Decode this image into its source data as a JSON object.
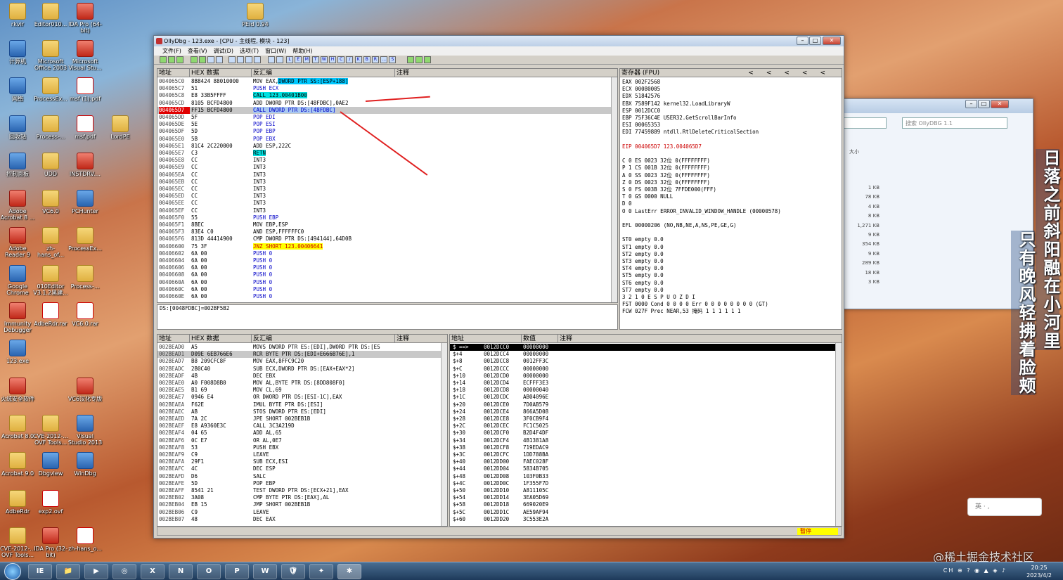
{
  "desktop_icons": [
    {
      "label": "rkvir",
      "icon": "file-icon",
      "kind": "folder"
    },
    {
      "label": "Editor010...",
      "icon": "folder-icon",
      "kind": "folder"
    },
    {
      "label": "IDA Pro (64-bit)",
      "icon": "ida-icon",
      "kind": "red"
    },
    {
      "label": "计算机",
      "icon": "computer-icon",
      "kind": "app"
    },
    {
      "label": "Microsoft Office 2003",
      "icon": "folder-icon",
      "kind": "folder"
    },
    {
      "label": "Microsoft Visual Stu...",
      "icon": "vs-icon",
      "kind": "red"
    },
    {
      "label": "网络",
      "icon": "network-icon",
      "kind": "app"
    },
    {
      "label": "ProcessEx...",
      "icon": "folder-icon",
      "kind": "folder"
    },
    {
      "label": "msf (1).pdf",
      "icon": "pdf-icon",
      "kind": "pdf"
    },
    {
      "label": "回收站",
      "icon": "recycle-bin-icon",
      "kind": "app"
    },
    {
      "label": "Process-...",
      "icon": "folder-icon",
      "kind": "folder"
    },
    {
      "label": "msf.pdf",
      "icon": "pdf-icon",
      "kind": "pdf"
    },
    {
      "label": "LordPE",
      "icon": "lordpe-icon",
      "kind": "folder"
    },
    {
      "label": "控制面板",
      "icon": "control-panel-icon",
      "kind": "app"
    },
    {
      "label": "UDD",
      "icon": "folder-icon",
      "kind": "folder"
    },
    {
      "label": "INSTDRV....",
      "icon": "sys-icon",
      "kind": "red"
    },
    {
      "label": "Adobe Acrobat 8 ...",
      "icon": "acrobat-icon",
      "kind": "red"
    },
    {
      "label": "VC6.0",
      "icon": "folder-icon",
      "kind": "folder"
    },
    {
      "label": "PCHunter",
      "icon": "pchunter-icon",
      "kind": "app"
    },
    {
      "label": "Adobe Reader 9",
      "icon": "reader-icon",
      "kind": "red"
    },
    {
      "label": "zh-hans_of...",
      "icon": "folder-icon",
      "kind": "folder"
    },
    {
      "label": "ProcessEx...",
      "icon": "folder-icon",
      "kind": "folder"
    },
    {
      "label": "Google Chrome",
      "icon": "chrome-icon",
      "kind": "app"
    },
    {
      "label": "010Editor V3.1.2黑建...",
      "icon": "editor-icon",
      "kind": "folder"
    },
    {
      "label": "Process-...",
      "icon": "folder-icon",
      "kind": "folder"
    },
    {
      "label": "Immunity Debugger",
      "icon": "immunity-icon",
      "kind": "red"
    },
    {
      "label": "AdbeRdr.rar",
      "icon": "archive-icon",
      "kind": "pdf"
    },
    {
      "label": "VC6.0.rar",
      "icon": "archive-icon",
      "kind": "pdf"
    },
    {
      "label": "123.exe",
      "icon": "exe-icon",
      "kind": "app"
    },
    {
      "label": "火绒安全软件",
      "icon": "huorong-icon",
      "kind": "red"
    },
    {
      "label": "VC6汉化专版",
      "icon": "vc6-icon",
      "kind": "red"
    },
    {
      "label": "Acrobat 8.0",
      "icon": "folder-icon",
      "kind": "folder"
    },
    {
      "label": "CVE-2012-... OVF Tools...",
      "icon": "folder-icon",
      "kind": "folder"
    },
    {
      "label": "Visual Studio 2013",
      "icon": "vs2013-icon",
      "kind": "app"
    },
    {
      "label": "Acrobat 9.0",
      "icon": "folder-icon",
      "kind": "folder"
    },
    {
      "label": "Dbgview",
      "icon": "dbgview-icon",
      "kind": "app"
    },
    {
      "label": "WinDbg",
      "icon": "windbg-icon",
      "kind": "app"
    },
    {
      "label": "AdbeRdr",
      "icon": "folder-icon",
      "kind": "folder"
    },
    {
      "label": "exp2.ovf",
      "icon": "file-icon",
      "kind": "pdf"
    },
    {
      "label": "CVE-2012-... OVF Tools...",
      "icon": "folder-icon",
      "kind": "folder"
    },
    {
      "label": "IDA Pro (32-bit)",
      "icon": "ida-icon",
      "kind": "red"
    },
    {
      "label": "zh-hans_o...",
      "icon": "file-icon",
      "kind": "pdf"
    },
    {
      "label": "PEid 0.94",
      "icon": "folder-icon",
      "kind": "folder"
    }
  ],
  "olly": {
    "title": "OllyDbg - 123.exe - [CPU - 主线程, 模块 - 123]",
    "menu": [
      "文件(F)",
      "查看(V)",
      "调试(D)",
      "选项(T)",
      "窗口(W)",
      "帮助(H)"
    ],
    "toolbar_letters": [
      "L",
      "E",
      "M",
      "T",
      "W",
      "H",
      "C",
      "/",
      "K",
      "B",
      "R",
      "...",
      "S"
    ],
    "disasm_headers": [
      "地址",
      "HEX 数据",
      "反汇编",
      "注释"
    ],
    "disasm_rows": [
      {
        "addr": "004065C0",
        "hex": "8B8424 88010000",
        "asm": "MOV EAX,DWORD PTR SS:[ESP+188]",
        "style": "hl-blue-operand"
      },
      {
        "addr": "004065C7",
        "hex": "51",
        "asm": "PUSH ECX",
        "style": "push"
      },
      {
        "addr": "004065C8",
        "hex": "E8 33B5FFFF",
        "asm": "CALL 123.00401B00",
        "style": "call"
      },
      {
        "addr": "004065CD",
        "hex": "8105 BCFD4800",
        "asm": "ADD DWORD PTR DS:[48FDBC],0AE2",
        "style": "add"
      },
      {
        "addr": "004065D7",
        "hex": "FF15 BCFD4800",
        "asm": "CALL DWORD PTR DS:[48FDBC]",
        "style": "eip"
      },
      {
        "addr": "004065DD",
        "hex": "5F",
        "asm": "POP EDI",
        "style": "pop"
      },
      {
        "addr": "004065DE",
        "hex": "5E",
        "asm": "POP ESI",
        "style": "pop"
      },
      {
        "addr": "004065DF",
        "hex": "5D",
        "asm": "POP EBP",
        "style": "pop"
      },
      {
        "addr": "004065E0",
        "hex": "5B",
        "asm": "POP EBX",
        "style": "pop"
      },
      {
        "addr": "004065E1",
        "hex": "81C4 2C220000",
        "asm": "ADD ESP,222C",
        "style": "add2"
      },
      {
        "addr": "004065E7",
        "hex": "C3",
        "asm": "RETN",
        "style": "retn"
      },
      {
        "addr": "004065E8",
        "hex": "CC",
        "asm": "INT3",
        "style": ""
      },
      {
        "addr": "004065E9",
        "hex": "CC",
        "asm": "INT3",
        "style": ""
      },
      {
        "addr": "004065EA",
        "hex": "CC",
        "asm": "INT3",
        "style": ""
      },
      {
        "addr": "004065EB",
        "hex": "CC",
        "asm": "INT3",
        "style": ""
      },
      {
        "addr": "004065EC",
        "hex": "CC",
        "asm": "INT3",
        "style": ""
      },
      {
        "addr": "004065ED",
        "hex": "CC",
        "asm": "INT3",
        "style": ""
      },
      {
        "addr": "004065EE",
        "hex": "CC",
        "asm": "INT3",
        "style": ""
      },
      {
        "addr": "004065EF",
        "hex": "CC",
        "asm": "INT3",
        "style": ""
      },
      {
        "addr": "004065F0",
        "hex": "55",
        "asm": "PUSH EBP",
        "style": "push"
      },
      {
        "addr": "004065F1",
        "hex": "8BEC",
        "asm": "MOV EBP,ESP",
        "style": ""
      },
      {
        "addr": "004065F3",
        "hex": "83E4 C0",
        "asm": "AND ESP,FFFFFFC0",
        "style": "and"
      },
      {
        "addr": "004065F6",
        "hex": "813D 44414900",
        "asm": "CMP DWORD PTR DS:[494144],64D0B",
        "style": "cmp"
      },
      {
        "addr": "00406600",
        "hex": "75 3F",
        "asm": "JNZ SHORT 123.00406641",
        "style": "jnz"
      },
      {
        "addr": "00406602",
        "hex": "6A 00",
        "asm": "PUSH 0",
        "style": "push0"
      },
      {
        "addr": "00406604",
        "hex": "6A 00",
        "asm": "PUSH 0",
        "style": "push0"
      },
      {
        "addr": "00406606",
        "hex": "6A 00",
        "asm": "PUSH 0",
        "style": "push0"
      },
      {
        "addr": "00406608",
        "hex": "6A 00",
        "asm": "PUSH 0",
        "style": "push0"
      },
      {
        "addr": "0040660A",
        "hex": "6A 00",
        "asm": "PUSH 0",
        "style": "push0"
      },
      {
        "addr": "0040660C",
        "hex": "6A 00",
        "asm": "PUSH 0",
        "style": "push0"
      },
      {
        "addr": "0040660E",
        "hex": "6A 00",
        "asm": "PUSH 0",
        "style": "push0"
      }
    ],
    "info_line": "DS:[0048FDBC]=002BF5B2",
    "registers_header": "寄存器 (FPU)",
    "registers_nav": [
      "<",
      "<",
      "<",
      "<",
      "<"
    ],
    "registers": [
      "EAX 002F2568",
      "ECX 00080005",
      "EDX 51842576",
      "EBX 7589F142 kernel32.LoadLibraryW",
      "ESP 0012DCC0",
      "EBP 75F36C4E USER32.GetScrollBarInfo",
      "ESI 00065353",
      "EDI 77459889 ntdll.RtlDeleteCriticalSection",
      "",
      "EIP 004065D7 123.004065D7",
      "",
      "C 0  ES 0023 32位 0(FFFFFFFF)",
      "P 1  CS 001B 32位 0(FFFFFFFF)",
      "A 0  SS 0023 32位 0(FFFFFFFF)",
      "Z 0  DS 0023 32位 0(FFFFFFFF)",
      "S 0  FS 003B 32位 7FFDE000(FFF)",
      "T 0  GS 0000 NULL",
      "D 0",
      "O 0  LastErr ERROR_INVALID_WINDOW_HANDLE (00000578)",
      "",
      "EFL 00000206 (NO,NB,NE,A,NS,PE,GE,G)",
      "",
      "ST0 empty 0.0",
      "ST1 empty 0.0",
      "ST2 empty 0.0",
      "ST3 empty 0.0",
      "ST4 empty 0.0",
      "ST5 empty 0.0",
      "ST6 empty 0.0",
      "ST7 empty 0.0",
      "               3 2 1 0      E S P U O Z D I",
      "FST 0000  Cond 0 0 0 0  Err 0 0 0 0 0 0 0 0  (GT)",
      "FCW 027F  Prec NEAR,53  掩码    1 1 1 1 1 1"
    ],
    "dump_headers": [
      "地址",
      "HEX 数据",
      "反汇编",
      "注释"
    ],
    "dump_rows": [
      {
        "addr": "002BEAD0",
        "hex": "A5",
        "asm": "MOVS DWORD PTR ES:[EDI],DWORD PTR DS:[ES"
      },
      {
        "addr": "002BEAD1",
        "hex": "D09E 6EB766E6",
        "asm": "RCR BYTE PTR DS:[EDI+E666B76E],1"
      },
      {
        "addr": "002BEAD7",
        "hex": "B8 209CFC8F",
        "asm": "MOV EAX,8FFC9C20"
      },
      {
        "addr": "002BEADC",
        "hex": "2B0C40",
        "asm": "SUB ECX,DWORD PTR DS:[EAX+EAX*2]"
      },
      {
        "addr": "002BEADF",
        "hex": "4B",
        "asm": "DEC EBX"
      },
      {
        "addr": "002BEAE0",
        "hex": "A0 F008D8B0",
        "asm": "MOV AL,BYTE PTR DS:[8DD808F0]"
      },
      {
        "addr": "002BEAE5",
        "hex": "B1 69",
        "asm": "MOV CL,69"
      },
      {
        "addr": "002BEAE7",
        "hex": "0946 E4",
        "asm": "OR DWORD PTR DS:[ESI-1C],EAX"
      },
      {
        "addr": "002BEAEA",
        "hex": "F62E",
        "asm": "IMUL BYTE PTR DS:[ESI]"
      },
      {
        "addr": "002BEAEC",
        "hex": "AB",
        "asm": "STOS DWORD PTR ES:[EDI]"
      },
      {
        "addr": "002BEAED",
        "hex": "7A 2C",
        "asm": "JPE SHORT 002BEB1B"
      },
      {
        "addr": "002BEAEF",
        "hex": "E8 A9360E3C",
        "asm": "CALL 3C3A219D"
      },
      {
        "addr": "002BEAF4",
        "hex": "04 65",
        "asm": "ADD AL,65"
      },
      {
        "addr": "002BEAF6",
        "hex": "0C E7",
        "asm": "OR AL,0E7"
      },
      {
        "addr": "002BEAF8",
        "hex": "53",
        "asm": "PUSH EBX"
      },
      {
        "addr": "002BEAF9",
        "hex": "C9",
        "asm": "LEAVE"
      },
      {
        "addr": "002BEAFA",
        "hex": "29F1",
        "asm": "SUB ECX,ESI"
      },
      {
        "addr": "002BEAFC",
        "hex": "4C",
        "asm": "DEC ESP"
      },
      {
        "addr": "002BEAFD",
        "hex": "D6",
        "asm": "SALC"
      },
      {
        "addr": "002BEAFE",
        "hex": "5D",
        "asm": "POP EBP"
      },
      {
        "addr": "002BEAFF",
        "hex": "8541 21",
        "asm": "TEST DWORD PTR DS:[ECX+21],EAX"
      },
      {
        "addr": "002BEB02",
        "hex": "3A08",
        "asm": "CMP BYTE PTR DS:[EAX],AL"
      },
      {
        "addr": "002BEB04",
        "hex": "EB 15",
        "asm": "JMP SHORT 002BEB1B"
      },
      {
        "addr": "002BEB06",
        "hex": "C9",
        "asm": "LEAVE"
      },
      {
        "addr": "002BEB07",
        "hex": "48",
        "asm": "DEC EAX"
      }
    ],
    "stack_headers": [
      "地址",
      "数值",
      "注释"
    ],
    "stack_rows": [
      {
        "off": "$ ==>",
        "addr": "0012DCC0",
        "val": "00000000"
      },
      {
        "off": "$+4",
        "addr": "0012DCC4",
        "val": "00000000"
      },
      {
        "off": "$+8",
        "addr": "0012DCC8",
        "val": "0012FF3C"
      },
      {
        "off": "$+C",
        "addr": "0012DCCC",
        "val": "00000000"
      },
      {
        "off": "$+10",
        "addr": "0012DCD0",
        "val": "00000000"
      },
      {
        "off": "$+14",
        "addr": "0012DCD4",
        "val": "ECFFF3E3"
      },
      {
        "off": "$+18",
        "addr": "0012DCD8",
        "val": "00000040"
      },
      {
        "off": "$+1C",
        "addr": "0012DCDC",
        "val": "AB04096E"
      },
      {
        "off": "$+20",
        "addr": "0012DCE0",
        "val": "7D0AB579"
      },
      {
        "off": "$+24",
        "addr": "0012DCE4",
        "val": "866A5D08"
      },
      {
        "off": "$+28",
        "addr": "0012DCE8",
        "val": "3F0CB9F4"
      },
      {
        "off": "$+2C",
        "addr": "0012DCEC",
        "val": "FC1C5025"
      },
      {
        "off": "$+30",
        "addr": "0012DCF0",
        "val": "B2D4F4DF"
      },
      {
        "off": "$+34",
        "addr": "0012DCF4",
        "val": "4B1381A8"
      },
      {
        "off": "$+38",
        "addr": "0012DCF8",
        "val": "719EDAC9"
      },
      {
        "off": "$+3C",
        "addr": "0012DCFC",
        "val": "1DD788BA"
      },
      {
        "off": "$+40",
        "addr": "0012DD00",
        "val": "FAEC028F"
      },
      {
        "off": "$+44",
        "addr": "0012DD04",
        "val": "5834B705"
      },
      {
        "off": "$+48",
        "addr": "0012DD08",
        "val": "103F0B33"
      },
      {
        "off": "$+4C",
        "addr": "0012DD0C",
        "val": "1F355F7D"
      },
      {
        "off": "$+50",
        "addr": "0012DD10",
        "val": "A811105C"
      },
      {
        "off": "$+54",
        "addr": "0012DD14",
        "val": "3EA05D69"
      },
      {
        "off": "$+58",
        "addr": "0012DD18",
        "val": "669020E9"
      },
      {
        "off": "$+5C",
        "addr": "0012DD1C",
        "val": "AE59AF94"
      },
      {
        "off": "$+60",
        "addr": "0012DD20",
        "val": "3C553E2A"
      }
    ],
    "status_paused": "暂停"
  },
  "explorer": {
    "search_placeholder": "搜索 OllyDBG 1.1",
    "size_header": "大小",
    "sizes": [
      "1 KB",
      "78 KB",
      "4 KB",
      "8 KB",
      "1,271 KB",
      "9 KB",
      "354 KB",
      "9 KB",
      "289 KB",
      "18 KB",
      "3 KB"
    ]
  },
  "overlay_text": {
    "vertical_1": "日落之前斜阳融在小河里",
    "vertical_2": "只有晚风轻拂着脸颊",
    "watermark": "@稀土掘金技术社区",
    "ime": "英 · ,"
  },
  "taskbar": {
    "apps": [
      "IE",
      "📁",
      "▶",
      "◎",
      "X",
      "N",
      "O",
      "P",
      "W",
      "🛡",
      "✦",
      "✱"
    ],
    "clock_time": "20:25",
    "clock_date": "2023/4/2",
    "tray": "CH ⊕ ? ◉ ▲ ◈ ♪"
  }
}
